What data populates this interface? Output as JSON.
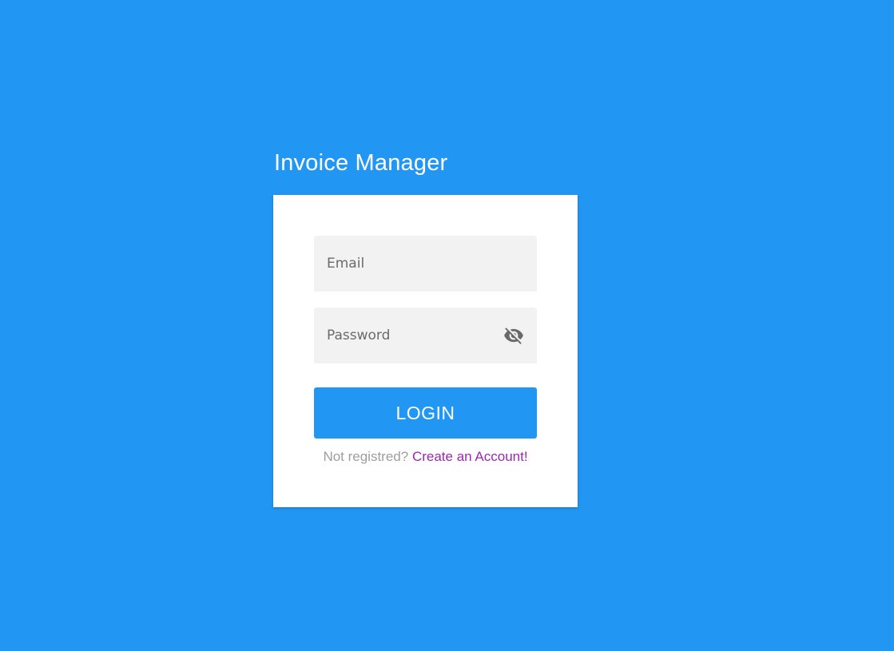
{
  "app": {
    "title": "Invoice Manager"
  },
  "login_form": {
    "email": {
      "value": "",
      "placeholder": "Email"
    },
    "password": {
      "value": "",
      "placeholder": "Password",
      "visibility_icon": "eye-off-icon"
    },
    "login_button_label": "LOGIN",
    "register_prompt": "Not registred?",
    "register_link_label": "Create an Account!"
  },
  "colors": {
    "background": "#2196f3",
    "button": "#2196f3",
    "link": "#9c27b0",
    "field_background": "#f2f2f2"
  }
}
